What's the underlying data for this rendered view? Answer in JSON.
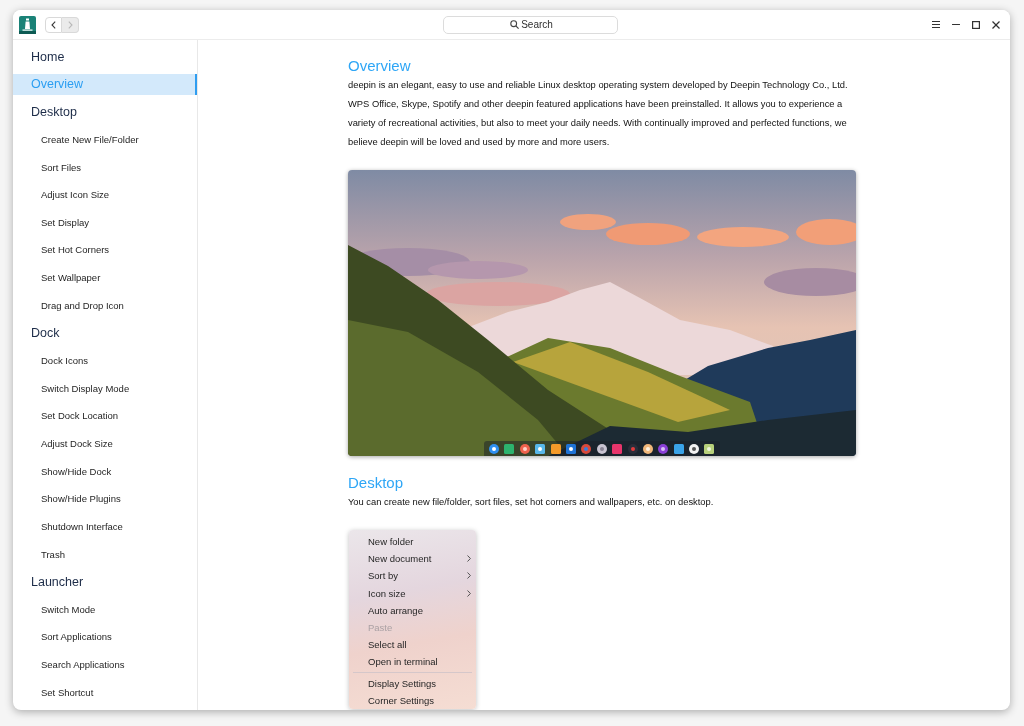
{
  "titlebar": {
    "nav": [
      {
        "kind": "back",
        "disabled": false
      },
      {
        "kind": "forward",
        "disabled": true
      }
    ],
    "search": {
      "placeholder": "Search"
    }
  },
  "sidebar": {
    "items": [
      {
        "label": "Home",
        "selected": false
      },
      {
        "label": "Overview",
        "selected": true
      },
      {
        "label": "Desktop",
        "selected": false,
        "children": [
          {
            "label": "Create New File/Folder",
            "selected": false
          },
          {
            "label": "Sort Files",
            "selected": false
          },
          {
            "label": "Adjust Icon Size",
            "selected": false
          },
          {
            "label": "Set Display",
            "selected": false
          },
          {
            "label": "Set Hot Corners",
            "selected": false
          },
          {
            "label": "Set Wallpaper",
            "selected": false
          },
          {
            "label": "Drag and Drop Icon",
            "selected": false
          }
        ]
      },
      {
        "label": "Dock",
        "selected": false,
        "children": [
          {
            "label": "Dock Icons",
            "selected": false
          },
          {
            "label": "Switch Display Mode",
            "selected": false
          },
          {
            "label": "Set Dock Location",
            "selected": false
          },
          {
            "label": "Adjust Dock Size",
            "selected": false
          },
          {
            "label": "Show/Hide Dock",
            "selected": false
          },
          {
            "label": "Show/Hide Plugins",
            "selected": false
          },
          {
            "label": "Shutdown Interface",
            "selected": false
          },
          {
            "label": "Trash",
            "selected": false
          }
        ]
      },
      {
        "label": "Launcher",
        "selected": false,
        "children": [
          {
            "label": "Switch Mode",
            "selected": false
          },
          {
            "label": "Sort Applications",
            "selected": false
          },
          {
            "label": "Search Applications",
            "selected": false
          },
          {
            "label": "Set Shortcut",
            "selected": false
          }
        ]
      }
    ]
  },
  "content": {
    "sections": [
      {
        "title": "Overview",
        "text": "deepin is an elegant, easy to use and reliable Linux desktop operating system developed by Deepin Technology Co., Ltd. WPS Office, Skype, Spotify and other deepin featured applications have been preinstalled. It allows you to experience a variety of recreational activities, but also to meet your daily needs. With continually improved and perfected functions, we believe deepin will be loved and used by more and more users.",
        "figure": {
          "kind": "desktop-screenshot"
        }
      },
      {
        "title": "Desktop",
        "text": "You can create new file/folder, sort files, set hot corners and wallpapers, etc. on desktop.",
        "figure": {
          "kind": "context-menu",
          "items": [
            {
              "kind": "item",
              "label": "New folder",
              "submenu": false,
              "disabled": false
            },
            {
              "kind": "item",
              "label": "New document",
              "submenu": true,
              "disabled": false
            },
            {
              "kind": "item",
              "label": "Sort by",
              "submenu": true,
              "disabled": false
            },
            {
              "kind": "item",
              "label": "Icon size",
              "submenu": true,
              "disabled": false
            },
            {
              "kind": "item",
              "label": "Auto arrange",
              "submenu": false,
              "disabled": false
            },
            {
              "kind": "item",
              "label": "Paste",
              "submenu": false,
              "disabled": true
            },
            {
              "kind": "item",
              "label": "Select all",
              "submenu": false,
              "disabled": false
            },
            {
              "kind": "item",
              "label": "Open in terminal",
              "submenu": false,
              "disabled": false
            },
            {
              "kind": "separator"
            },
            {
              "kind": "item",
              "label": "Display Settings",
              "submenu": false,
              "disabled": false
            },
            {
              "kind": "item",
              "label": "Corner Settings",
              "submenu": false,
              "disabled": false
            }
          ]
        }
      }
    ]
  }
}
